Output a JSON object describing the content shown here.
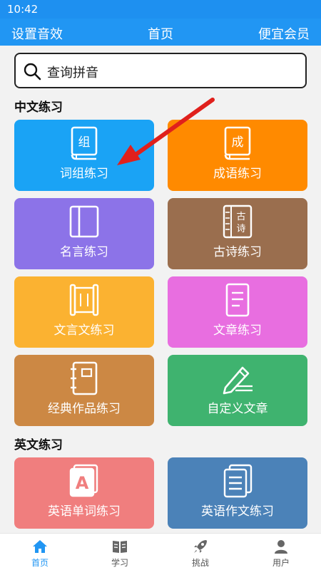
{
  "status_bar": {
    "time": "10:42"
  },
  "app_bar": {
    "left": "设置音效",
    "title": "首页",
    "right": "便宜会员"
  },
  "search": {
    "label": "查询拼音"
  },
  "sections": {
    "chinese": {
      "title": "中文练习",
      "tiles": [
        {
          "label": "词组练习",
          "icon": "book-icon",
          "icon_char": "组",
          "color": "#1aa3f5"
        },
        {
          "label": "成语练习",
          "icon": "book-icon",
          "icon_char": "成",
          "color": "#ff8a00"
        },
        {
          "label": "名言练习",
          "icon": "notebook-icon",
          "color": "#8c73e8"
        },
        {
          "label": "古诗练习",
          "icon": "scroll-book-icon",
          "icon_char_1": "古",
          "icon_char_2": "诗",
          "color": "#9a6e4e"
        },
        {
          "label": "文言文练习",
          "icon": "scroll-icon",
          "color": "#fbb231"
        },
        {
          "label": "文章练习",
          "icon": "document-icon",
          "color": "#e86ee0"
        },
        {
          "label": "经典作品练习",
          "icon": "notebook-icon",
          "color": "#cc8844"
        },
        {
          "label": "自定义文章",
          "icon": "pen-icon",
          "color": "#3fb36f"
        }
      ]
    },
    "english": {
      "title": "英文练习",
      "tiles": [
        {
          "label": "英语单词练习",
          "icon": "letter-a-icon",
          "icon_char": "A",
          "color": "#f07e7e"
        },
        {
          "label": "英语作文练习",
          "icon": "documents-icon",
          "color": "#4b82b8"
        }
      ]
    }
  },
  "bottom_nav": {
    "items": [
      {
        "label": "首页",
        "icon": "home-icon",
        "active": true
      },
      {
        "label": "学习",
        "icon": "open-book-icon",
        "active": false
      },
      {
        "label": "挑战",
        "icon": "rocket-icon",
        "active": false
      },
      {
        "label": "用户",
        "icon": "user-icon",
        "active": false
      }
    ]
  },
  "colors": {
    "primary": "#2196f3",
    "annotation_arrow": "#e0201c"
  }
}
